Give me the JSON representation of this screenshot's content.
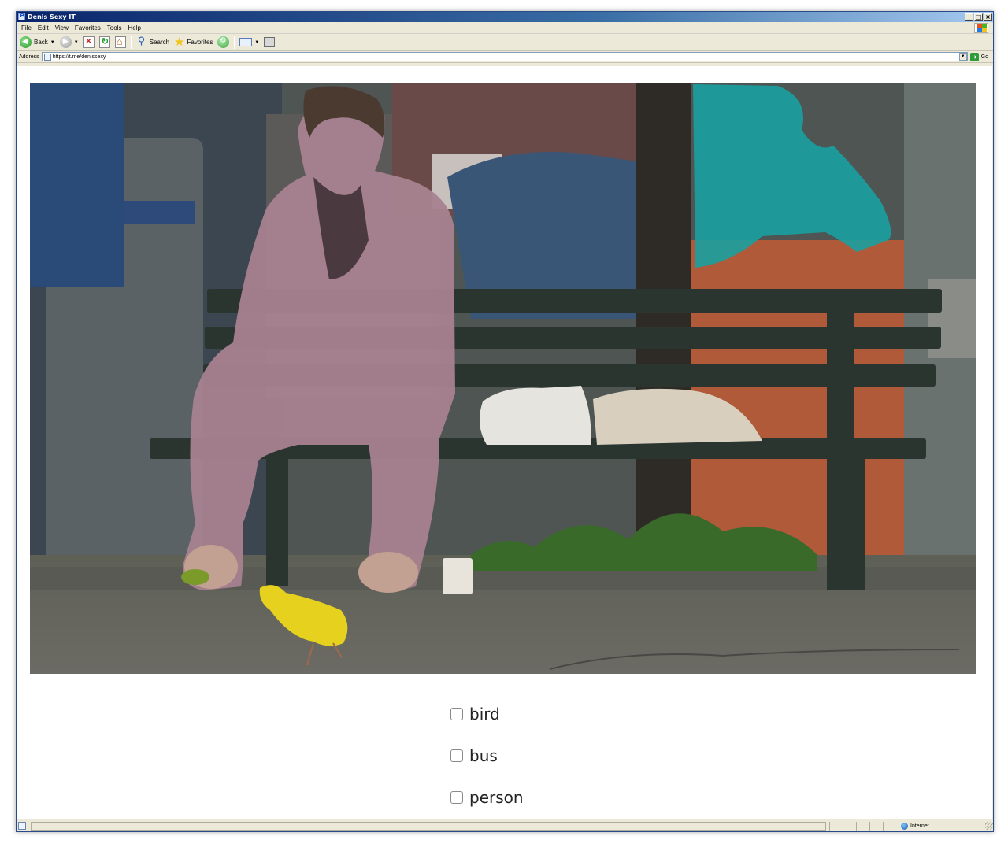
{
  "window": {
    "title": "Denis Sexy IT",
    "controls": [
      "_",
      "□",
      "×"
    ]
  },
  "menu": [
    "File",
    "Edit",
    "View",
    "Favorites",
    "Tools",
    "Help"
  ],
  "toolbar": {
    "back_label": "Back",
    "search_label": "Search",
    "favorites_label": "Favorites"
  },
  "address": {
    "label": "Address",
    "url": "https://t.me/denissexy",
    "go_label": "Go"
  },
  "image": {
    "segments": [
      "person",
      "bird"
    ]
  },
  "options": [
    {
      "label": "bird",
      "checked": false
    },
    {
      "label": "bus",
      "checked": false
    },
    {
      "label": "person",
      "checked": false
    }
  ],
  "status": {
    "zone": "Internet"
  },
  "colors": {
    "title_gradient_start": "#0a246a",
    "chrome": "#ece9d8",
    "person_mask": "#c8a0b4",
    "bird_mask": "#e6d21e",
    "teal_mask": "#14b4b4"
  }
}
